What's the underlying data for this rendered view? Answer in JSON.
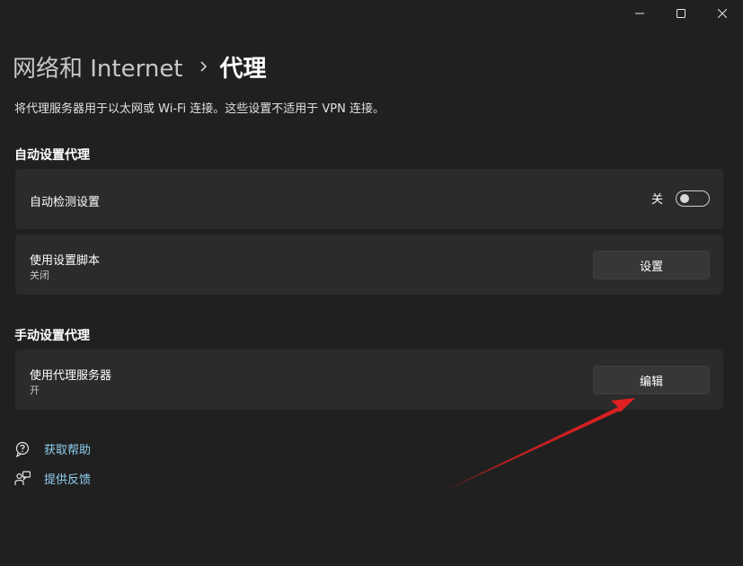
{
  "breadcrumb": {
    "parent": "网络和 Internet",
    "current": "代理"
  },
  "description": "将代理服务器用于以太网或 Wi-Fi 连接。这些设置不适用于 VPN 连接。",
  "auto_section": {
    "title": "自动设置代理",
    "detect": {
      "label": "自动检测设置",
      "toggle_state_label": "关",
      "toggle_on": false
    },
    "script": {
      "label": "使用设置脚本",
      "status": "关闭",
      "button_label": "设置"
    }
  },
  "manual_section": {
    "title": "手动设置代理",
    "proxy": {
      "label": "使用代理服务器",
      "status": "开",
      "button_label": "编辑"
    }
  },
  "links": {
    "help": "获取帮助",
    "feedback": "提供反馈"
  },
  "colors": {
    "background": "#202020",
    "card": "#2b2b2b",
    "link": "#8fd0f0",
    "annotation_arrow": "#e02020"
  },
  "icons": {
    "minimize": "minimize-icon",
    "maximize": "maximize-icon",
    "close": "close-icon",
    "breadcrumb_separator": "chevron-right-icon",
    "help": "help-icon",
    "feedback": "feedback-icon"
  }
}
